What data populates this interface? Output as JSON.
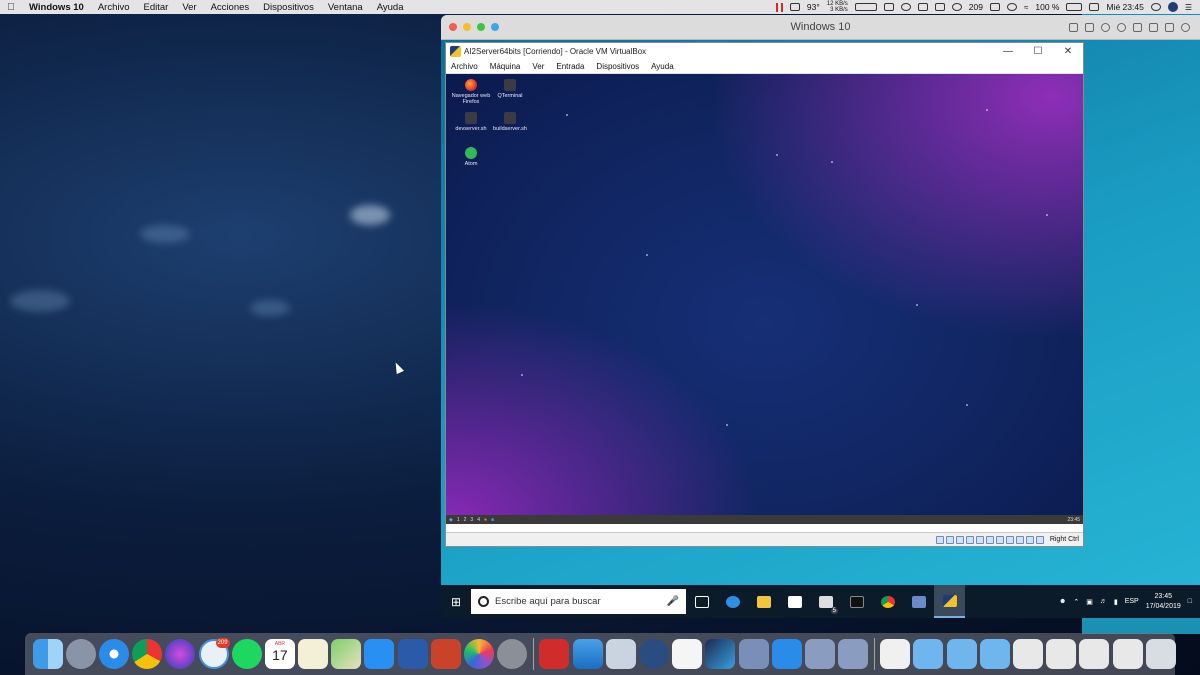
{
  "menubar": {
    "app_name": "Windows 10",
    "items": [
      "Archivo",
      "Editar",
      "Ver",
      "Acciones",
      "Dispositivos",
      "Ventana",
      "Ayuda"
    ],
    "temp": "93°",
    "net_up": "12 KB/s",
    "net_down": "3 KB/s",
    "badge_count": "209",
    "battery": "100 %",
    "clock": "Mié 23:45"
  },
  "parallels": {
    "title": "Windows 10"
  },
  "virtualbox": {
    "title": "AI2Server64bits [Corriendo] - Oracle VM VirtualBox",
    "menu": [
      "Archivo",
      "Máquina",
      "Ver",
      "Entrada",
      "Dispositivos",
      "Ayuda"
    ],
    "host_key": "Right Ctrl",
    "guest_desktop": {
      "icons": [
        {
          "label": "Navegador web Firefox",
          "kind": "firefox"
        },
        {
          "label": "QTerminal",
          "kind": "terminal"
        },
        {
          "label": "devserver.sh",
          "kind": "file"
        },
        {
          "label": "buildserver.sh",
          "kind": "file"
        },
        {
          "label": "Atom",
          "kind": "atom"
        }
      ],
      "workspaces": [
        "1",
        "2",
        "3",
        "4"
      ],
      "panel_clock": "23:45"
    }
  },
  "win_taskbar": {
    "search_placeholder": "Escribe aquí para buscar",
    "lang": "ESP",
    "time": "23:45",
    "date": "17/04/2019",
    "mail_badge": "5"
  },
  "dock": {
    "calendar_month": "ABR",
    "calendar_day": "17",
    "badge_count": "209",
    "apps": [
      "finder-icon",
      "launchpad-icon",
      "safari-icon",
      "chrome-icon",
      "siri-icon",
      "timing-icon",
      "spotify-icon",
      "calendar-icon",
      "notes-icon",
      "maps-icon",
      "appstore-icon",
      "word-icon",
      "powerpoint-icon",
      "photos-icon",
      "system-preferences-icon",
      "parallels-icon",
      "windows-vm-icon",
      "stickies-icon",
      "quicktime-icon",
      "text-file-icon",
      "affinity-icon",
      "virtualbox-icon",
      "windows-app-icon",
      "virtualbox-vm-icon",
      "virtualbox-vm2-icon",
      "document-icon",
      "folder-icon",
      "folder-apps-icon",
      "folder-windows-icon",
      "screenshot-icon",
      "screenshot2-icon",
      "screenshot3-icon",
      "screenshot4-icon",
      "trash-icon"
    ]
  }
}
